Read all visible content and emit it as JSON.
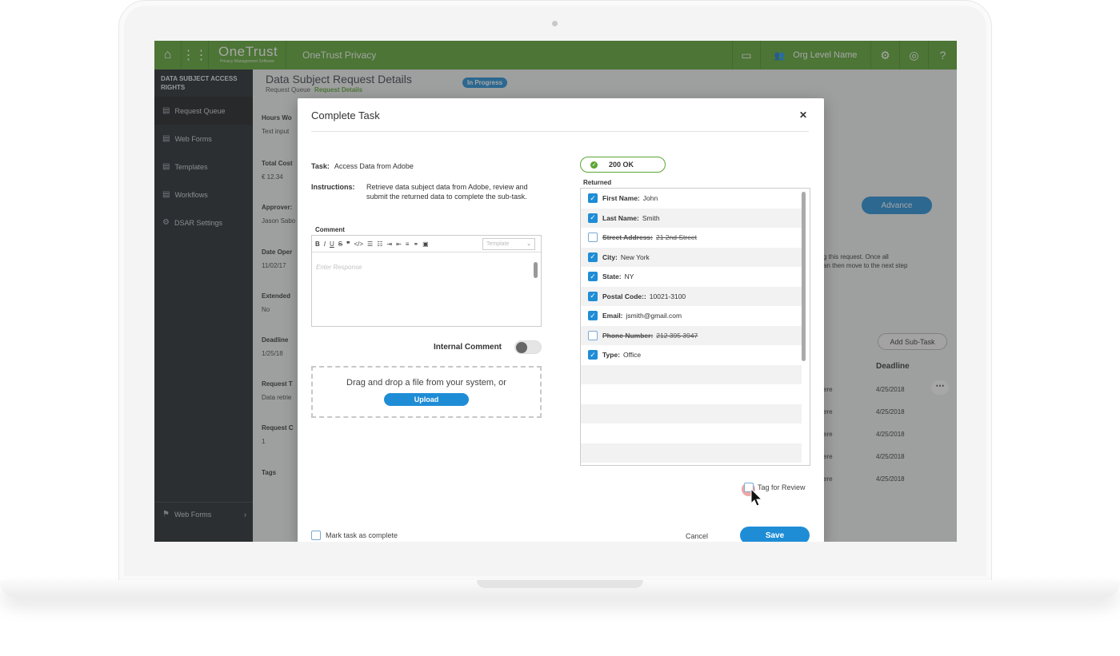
{
  "topbar": {
    "logo": "OneTrust",
    "logo_sub": "Privacy Management Software",
    "app_name": "OneTrust Privacy",
    "org_label": "Org Level Name"
  },
  "sidebar": {
    "heading": "DATA SUBJECT ACCESS RIGHTS",
    "items": [
      {
        "label": "Request Queue",
        "icon": "document-icon"
      },
      {
        "label": "Web Forms",
        "icon": "document-icon"
      },
      {
        "label": "Templates",
        "icon": "document-icon"
      },
      {
        "label": "Workflows",
        "icon": "document-icon"
      },
      {
        "label": "DSAR Settings",
        "icon": "gear-icon"
      }
    ],
    "bottom_label": "Web Forms"
  },
  "page": {
    "title": "Data Subject Request Details",
    "breadcrumb_root": "Request Queue",
    "breadcrumb_current": "Request Details",
    "status": "In Progress",
    "fields": [
      {
        "label": "Hours Wo",
        "value": "Text input"
      },
      {
        "label": "Total Cost",
        "value": "€ 12.34"
      },
      {
        "label": "Approver:",
        "value": "Jason Sabo"
      },
      {
        "label": "Date Oper",
        "value": "11/02/17"
      },
      {
        "label": "Extended",
        "value": "No"
      },
      {
        "label": "Deadline",
        "value": "1/25/18"
      },
      {
        "label": "Request T",
        "value": "Data retrie"
      },
      {
        "label": "Request C",
        "value": "1"
      },
      {
        "label": "Tags",
        "value": ""
      }
    ],
    "advance_label": "Advance",
    "info_line1": "g this request. Once all",
    "info_line2": "an then move to the next step",
    "add_subtask_label": "Add Sub-Task",
    "deadline_header": "Deadline",
    "rows": [
      {
        "prefix": "ere",
        "deadline": "4/25/2018"
      },
      {
        "prefix": "ere",
        "deadline": "4/25/2018"
      },
      {
        "prefix": "ere",
        "deadline": "4/25/2018"
      },
      {
        "prefix": "ere",
        "deadline": "4/25/2018"
      },
      {
        "prefix": "ere",
        "deadline": "4/25/2018"
      }
    ]
  },
  "modal": {
    "title": "Complete Task",
    "task_label": "Task:",
    "task_value": "Access Data from Adobe",
    "instructions_label": "Instructions:",
    "instructions_value": "Retrieve data subject data from Adobe, review and submit the returned data to complete the sub-task.",
    "comment_label": "Comment",
    "editor_placeholder": "Enter Response",
    "template_placeholder": "Template",
    "internal_comment_label": "Internal Comment",
    "drop_text": "Drag and drop a file from your system, or",
    "upload_label": "Upload",
    "status_label": "200 OK",
    "returned_label": "Returned",
    "returned": [
      {
        "field": "First Name:",
        "value": "John",
        "checked": true
      },
      {
        "field": "Last Name:",
        "value": "Smith",
        "checked": true
      },
      {
        "field": "Street Address:",
        "value": "21 2nd Street",
        "checked": false
      },
      {
        "field": "City:",
        "value": "New York",
        "checked": true
      },
      {
        "field": "State:",
        "value": "NY",
        "checked": true
      },
      {
        "field": "Postal Code::",
        "value": "10021-3100",
        "checked": true
      },
      {
        "field": "Email:",
        "value": "jsmith@gmail.com",
        "checked": true
      },
      {
        "field": "Phone Number:",
        "value": "212 395 3947",
        "checked": false
      },
      {
        "field": "Type:",
        "value": "Office",
        "checked": true
      }
    ],
    "tag_review_label": "Tag for Review",
    "mark_complete_label": "Mark task as complete",
    "cancel_label": "Cancel",
    "save_label": "Save"
  },
  "colors": {
    "brand_green": "#5aa532",
    "accent_blue": "#1f8dd6",
    "sidebar_bg": "#1e2529"
  }
}
